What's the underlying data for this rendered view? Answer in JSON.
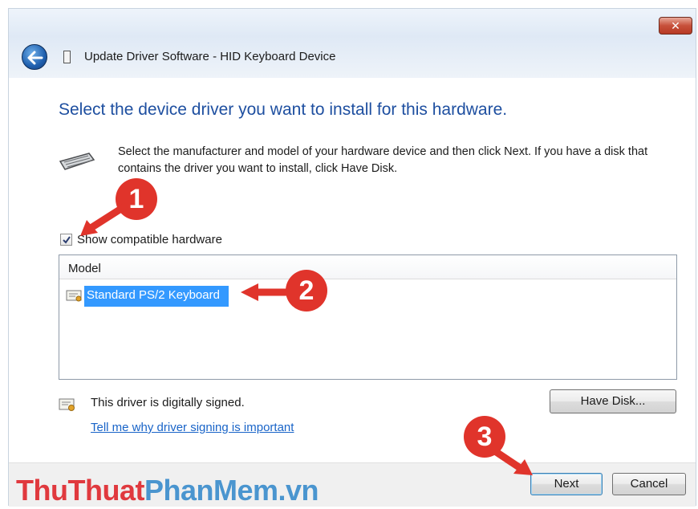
{
  "window": {
    "title": "Update Driver Software - HID Keyboard Device",
    "close_label": "✕"
  },
  "main": {
    "heading": "Select the device driver you want to install for this hardware.",
    "description": "Select the manufacturer and model of your hardware device and then click Next. If you have a disk that contains the driver you want to install, click Have Disk.",
    "show_compatible_label": "Show compatible hardware",
    "show_compatible_checked": true,
    "model_list": {
      "header": "Model",
      "items": [
        {
          "label": "Standard PS/2 Keyboard",
          "selected": true
        }
      ]
    },
    "signed_text": "This driver is digitally signed.",
    "signing_link": "Tell me why driver signing is important",
    "have_disk_label": "Have Disk..."
  },
  "footer": {
    "next_label": "Next",
    "cancel_label": "Cancel"
  },
  "annotations": {
    "marker_1": "1",
    "marker_2": "2",
    "marker_3": "3"
  },
  "watermark": {
    "part_1": "ThuThuat",
    "part_2": "PhanMem.vn"
  },
  "colors": {
    "heading": "#1e4fa0",
    "selection": "#3399ff",
    "link": "#1964c8",
    "marker": "#e0342b"
  },
  "icons": {
    "back": "back-arrow-icon",
    "keyboard": "keyboard-icon",
    "certificate": "certificate-icon"
  }
}
